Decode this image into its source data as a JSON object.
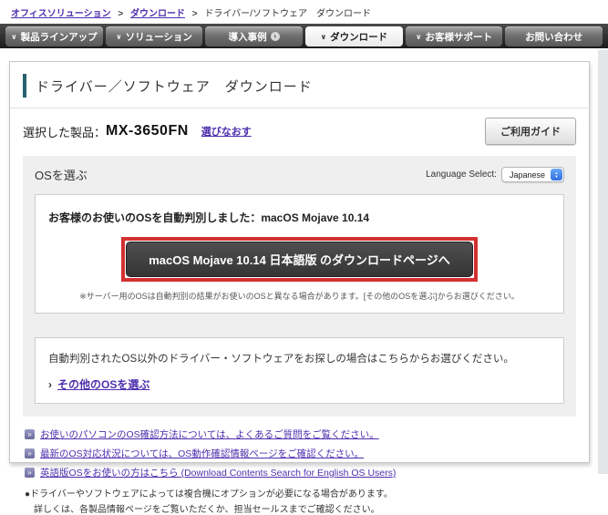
{
  "colors": {
    "accent_red": "#d43030",
    "link_purple": "#4d2fae",
    "teal_bar": "#27606e",
    "button_dark": "#3b3b3b"
  },
  "icons": {
    "chevron_down": "∨",
    "breadcrumb_sep": ">",
    "arrow_right": "›",
    "link_arrow": "»",
    "external_mark": "›",
    "select_up": "▲",
    "select_down": "▼"
  },
  "breadcrumb": {
    "items": [
      {
        "label": "オフィスソリューション"
      },
      {
        "label": "ダウンロード"
      },
      {
        "label": "ドライバー/ソフトウェア　ダウンロード"
      }
    ]
  },
  "nav": {
    "tabs": [
      {
        "label": "製品ラインアップ"
      },
      {
        "label": "ソリューション"
      },
      {
        "label": "導入事例"
      },
      {
        "label": "ダウンロード"
      },
      {
        "label": "お客様サポート"
      },
      {
        "label": "お問い合わせ"
      }
    ]
  },
  "main": {
    "title": "ドライバー／ソフトウェア　ダウンロード",
    "product": {
      "label": "選択した製品：",
      "name": "MX-3650FN",
      "reselect": "選びなおす",
      "guide_button": "ご利用ガイド"
    },
    "os_section": {
      "heading": "OSを選ぶ",
      "language": {
        "label": "Language Select:",
        "value": "Japanese"
      },
      "detected": {
        "message": "お客様のお使いのOSを自動判別しました：macOS Mojave 10.14",
        "button": "macOS Mojave 10.14 日本語版 のダウンロードページへ",
        "note": "※サーバー用のOSは自動判別の結果がお使いのOSと異なる場合があります。[その他のOSを選ぶ]からお選びください。"
      },
      "other": {
        "message": "自動判別されたOS以外のドライバー・ソフトウェアをお探しの場合はこちらからお選びください。",
        "link": "その他のOSを選ぶ"
      }
    },
    "footer": {
      "links": [
        "お使いのパソコンのOS確認方法については、よくあるご質問をご覧ください。",
        "最新のOS対応状況については、OS動作確認情報ページをご確認ください。",
        "英語版OSをお使いの方はこちら (Download Contents Search for English OS Users)"
      ],
      "notes": [
        "●ドライバーやソフトウェアによっては複合機にオプションが必要になる場合があります。",
        "詳しくは、各製品情報ページをご覧いただくか、担当セールスまでご確認ください。"
      ]
    }
  }
}
